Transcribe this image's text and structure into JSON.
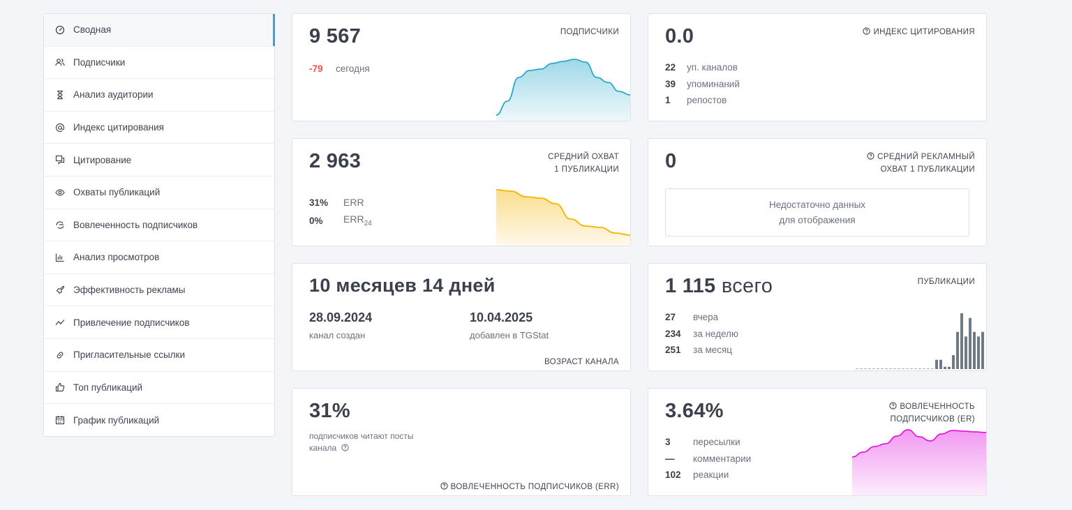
{
  "sidebar": {
    "items": [
      {
        "label": "Сводная",
        "icon": "dashboard-icon"
      },
      {
        "label": "Подписчики",
        "icon": "users-icon"
      },
      {
        "label": "Анализ аудитории",
        "icon": "hourglass-icon"
      },
      {
        "label": "Индекс цитирования",
        "icon": "at-icon"
      },
      {
        "label": "Цитирование",
        "icon": "quote-icon"
      },
      {
        "label": "Охваты публикаций",
        "icon": "eye-icon"
      },
      {
        "label": "Вовлеченность подписчиков",
        "icon": "hand-icon"
      },
      {
        "label": "Анализ просмотров",
        "icon": "bar-chart-icon"
      },
      {
        "label": "Эффективность рекламы",
        "icon": "rocket-icon"
      },
      {
        "label": "Привлечение подписчиков",
        "icon": "trend-icon"
      },
      {
        "label": "Пригласительные ссылки",
        "icon": "link-icon"
      },
      {
        "label": "Топ публикаций",
        "icon": "thumb-up-icon"
      },
      {
        "label": "График публикаций",
        "icon": "calendar-icon"
      }
    ]
  },
  "subscribers": {
    "value": "9 567",
    "title": "ПОДПИСЧИКИ",
    "delta": "-79",
    "delta_label": "сегодня",
    "sparkline": [
      8,
      28,
      62,
      72,
      74,
      82,
      85,
      88,
      84,
      62,
      55,
      42,
      37
    ]
  },
  "citation": {
    "value": "0.0",
    "title": "ИНДЕКС ЦИТИРОВАНИЯ",
    "rows": [
      {
        "num": "22",
        "label": "уп. каналов"
      },
      {
        "num": "39",
        "label": "упоминаний"
      },
      {
        "num": "1",
        "label": "репостов"
      }
    ]
  },
  "reach": {
    "value": "2 963",
    "title_line1": "СРЕДНИЙ ОХВАТ",
    "title_line2": "1 ПУБЛИКАЦИИ",
    "rows": [
      {
        "num": "31%",
        "label": "ERR"
      },
      {
        "num": "0%",
        "label": "ERR",
        "sub": "24"
      }
    ],
    "sparkline": [
      80,
      78,
      70,
      68,
      60,
      38,
      28,
      26,
      18,
      15
    ]
  },
  "ad_reach": {
    "value": "0",
    "title_line1": "СРЕДНИЙ РЕКЛАМНЫЙ",
    "title_line2": "ОХВАТ 1 ПУБЛИКАЦИИ",
    "nodata_line1": "Недостаточно данных",
    "nodata_line2": "для отображения"
  },
  "age": {
    "value": "10 месяцев 14 дней",
    "created_date": "28.09.2024",
    "created_label": "канал создан",
    "added_date": "10.04.2025",
    "added_label": "добавлен в TGStat",
    "title": "ВОЗРАСТ КАНАЛА"
  },
  "posts": {
    "value": "1 115",
    "suffix": "всего",
    "title": "ПУБЛИКАЦИИ",
    "rows": [
      {
        "num": "27",
        "label": "вчера"
      },
      {
        "num": "234",
        "label": "за неделю"
      },
      {
        "num": "251",
        "label": "за месяц"
      }
    ],
    "bars": [
      0,
      0,
      0,
      0,
      0,
      0,
      0,
      0,
      0,
      0,
      0,
      0,
      0,
      0,
      0,
      0,
      0,
      0,
      0,
      2,
      2,
      0.5,
      0.5,
      3,
      8,
      12,
      7,
      11,
      8,
      7,
      8
    ]
  },
  "err": {
    "value": "31%",
    "desc_line1": "подписчиков читают посты",
    "desc_line2": "канала",
    "title": "ВОВЛЕЧЕННОСТЬ ПОДПИСЧИКОВ (ERR)"
  },
  "er": {
    "value": "3.64%",
    "title_line1": "ВОВЛЕЧЕННОСТЬ",
    "title_line2": "ПОДПИСЧИКОВ (ER)",
    "rows": [
      {
        "num": "3",
        "label": "пересылки"
      },
      {
        "num": "—",
        "label": "комментарии"
      },
      {
        "num": "102",
        "label": "реакции"
      }
    ],
    "sparkline": [
      55,
      62,
      70,
      74,
      85,
      94,
      84,
      78,
      88,
      93,
      92,
      91,
      90
    ]
  },
  "colors": {
    "accent": "#3aa1d8",
    "subs_line": "#2aa8cc",
    "reach_line": "#f4b400",
    "er_line": "#e21be0",
    "bars": "#6f7a87",
    "negative": "#e8514e"
  }
}
